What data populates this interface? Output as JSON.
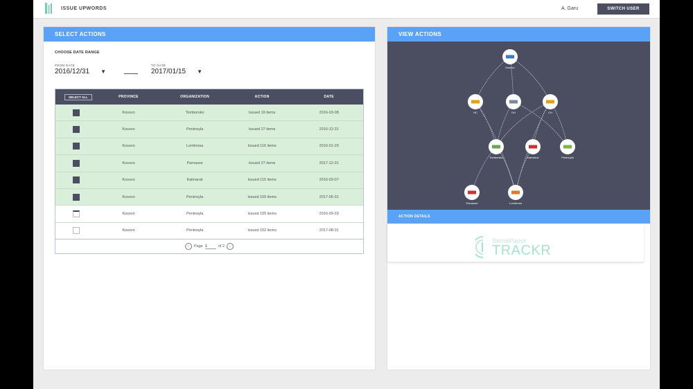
{
  "header": {
    "brand_name": "ISSUE UPWORDS",
    "user_name": "A. Garu",
    "switch_button": "SWITCH USER"
  },
  "select_panel": {
    "title": "SELECT ACTIONS",
    "range_label": "CHOOSE DATE RANGE",
    "from_label": "FROM DATE",
    "from_value": "2016/12/31",
    "to_label": "TO DATE",
    "to_value": "2017/01/15"
  },
  "table": {
    "select_all_label": "SELECT ALL",
    "columns": [
      "PROVINCE",
      "ORGANIZATION",
      "ACTION",
      "DATE"
    ],
    "rows": [
      {
        "checked": true,
        "province": "Kosovo",
        "organization": "Tomborsko",
        "action": "Issued 19 items",
        "date": "2016-03-08"
      },
      {
        "checked": true,
        "province": "Kosovo",
        "organization": "Peninoyla",
        "action": "Issued 27 items",
        "date": "2016-12-31"
      },
      {
        "checked": true,
        "province": "Kosovo",
        "organization": "Lombrosa",
        "action": "Issued 116 items",
        "date": "2016-01-29"
      },
      {
        "checked": true,
        "province": "Kosovo",
        "organization": "Parnasse",
        "action": "Issued 27 items",
        "date": "2017-12-31"
      },
      {
        "checked": true,
        "province": "Kosovo",
        "organization": "Kalmaruk",
        "action": "Issued 115 items",
        "date": "2016-03-07"
      },
      {
        "checked": true,
        "province": "Kosovo",
        "organization": "Peninoyla",
        "action": "Issued 105 items",
        "date": "2017-05-31"
      },
      {
        "checked": false,
        "province": "Kosovo",
        "organization": "Peninoyla",
        "action": "Issued 105 items",
        "date": "2016-09-29"
      },
      {
        "checked": false,
        "province": "Kosovo",
        "organization": "Peninoyla",
        "action": "Issued 102 items",
        "date": "2017-08-31"
      }
    ],
    "pager": {
      "prev": "‹",
      "page_label": "Page",
      "page_value": "1",
      "of_label": "of 2",
      "next": "›"
    }
  },
  "view_panel": {
    "title": "VIEW ACTIONS",
    "details_label": "ACTION DETAILS",
    "logo_top": "StonePaper",
    "logo_bottom": "TRACKR"
  },
  "graph": {
    "nodes": [
      {
        "id": "root",
        "label": "Kosovo",
        "color": "#3a7fc4"
      },
      {
        "id": "n1",
        "label": "HC",
        "color": "#e0a21b"
      },
      {
        "id": "n2",
        "label": "DH",
        "color": "#7a8a99"
      },
      {
        "id": "n3",
        "label": "CH",
        "color": "#e0a21b"
      },
      {
        "id": "n4",
        "label": "Tomborsko",
        "color": "#6aa84f"
      },
      {
        "id": "n5",
        "label": "Kalmaruk",
        "color": "#cc3333"
      },
      {
        "id": "n6",
        "label": "Peninoyla",
        "color": "#7ab648"
      },
      {
        "id": "n7",
        "label": "Parnasse",
        "color": "#cc3333"
      },
      {
        "id": "n8",
        "label": "Lombrosa",
        "color": "#d97b2b"
      }
    ],
    "edges": [
      [
        "root",
        "n1"
      ],
      [
        "root",
        "n2"
      ],
      [
        "root",
        "n3"
      ],
      [
        "n1",
        "n4"
      ],
      [
        "n1",
        "n8"
      ],
      [
        "n2",
        "n4"
      ],
      [
        "n2",
        "n6"
      ],
      [
        "n3",
        "n4"
      ],
      [
        "n3",
        "n5"
      ],
      [
        "n3",
        "n6"
      ],
      [
        "n3",
        "n8"
      ],
      [
        "n4",
        "n7"
      ],
      [
        "n4",
        "n8"
      ],
      [
        "n5",
        "n8"
      ]
    ]
  },
  "colors": {
    "accent_blue": "#5aa2f7",
    "dark_slate": "#4b4e60",
    "selected_row": "#d9efd9",
    "logo_green": "#a9e2cf"
  }
}
